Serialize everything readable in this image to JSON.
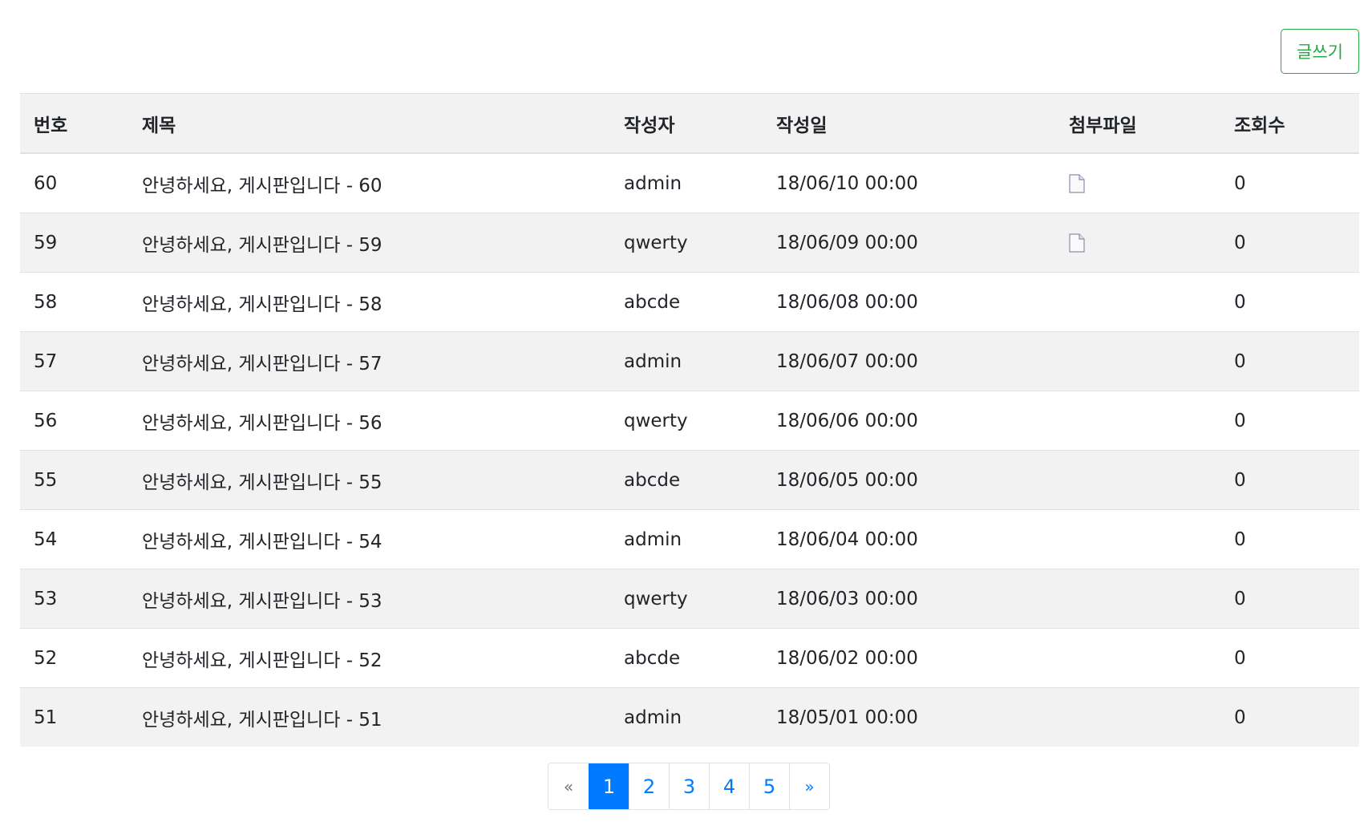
{
  "toolbar": {
    "write_label": "글쓰기"
  },
  "table": {
    "headers": [
      "번호",
      "제목",
      "작성자",
      "작성일",
      "첨부파일",
      "조회수"
    ],
    "rows": [
      {
        "no": "60",
        "title": "안녕하세요, 게시판입니다 - 60",
        "author": "admin",
        "date": "18/06/10  00:00",
        "attachment": true,
        "views": "0"
      },
      {
        "no": "59",
        "title": "안녕하세요, 게시판입니다 - 59",
        "author": "qwerty",
        "date": "18/06/09  00:00",
        "attachment": true,
        "views": "0"
      },
      {
        "no": "58",
        "title": "안녕하세요, 게시판입니다 - 58",
        "author": "abcde",
        "date": "18/06/08  00:00",
        "attachment": false,
        "views": "0"
      },
      {
        "no": "57",
        "title": "안녕하세요, 게시판입니다 - 57",
        "author": "admin",
        "date": "18/06/07  00:00",
        "attachment": false,
        "views": "0"
      },
      {
        "no": "56",
        "title": "안녕하세요, 게시판입니다 - 56",
        "author": "qwerty",
        "date": "18/06/06  00:00",
        "attachment": false,
        "views": "0"
      },
      {
        "no": "55",
        "title": "안녕하세요, 게시판입니다 - 55",
        "author": "abcde",
        "date": "18/06/05  00:00",
        "attachment": false,
        "views": "0"
      },
      {
        "no": "54",
        "title": "안녕하세요, 게시판입니다 - 54",
        "author": "admin",
        "date": "18/06/04  00:00",
        "attachment": false,
        "views": "0"
      },
      {
        "no": "53",
        "title": "안녕하세요, 게시판입니다 - 53",
        "author": "qwerty",
        "date": "18/06/03  00:00",
        "attachment": false,
        "views": "0"
      },
      {
        "no": "52",
        "title": "안녕하세요, 게시판입니다 - 52",
        "author": "abcde",
        "date": "18/06/02  00:00",
        "attachment": false,
        "views": "0"
      },
      {
        "no": "51",
        "title": "안녕하세요, 게시판입니다 - 51",
        "author": "admin",
        "date": "18/05/01  00:00",
        "attachment": false,
        "views": "0"
      }
    ]
  },
  "pagination": {
    "prev": "«",
    "pages": [
      "1",
      "2",
      "3",
      "4",
      "5"
    ],
    "active": "1",
    "next": "»"
  },
  "icons": {
    "attachment": "file-icon"
  },
  "colors": {
    "accent": "#007bff",
    "write_button": "#28a745",
    "stripe": "#f2f2f2"
  }
}
